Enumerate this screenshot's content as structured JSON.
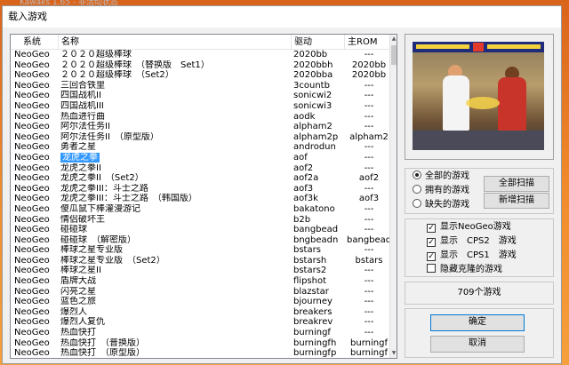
{
  "background_title": "Kawaks 1.65 - 非活动状态",
  "dialog": {
    "title": "载入游戏"
  },
  "list": {
    "columns": [
      "系统",
      "名称",
      "驱动",
      "主ROM"
    ],
    "rows": [
      {
        "sys": "NeoGeo",
        "name": "２０２０超级棒球",
        "drv": "2020bb",
        "main": "---"
      },
      {
        "sys": "NeoGeo",
        "name": "２０２０超级棒球　（替换版　Set1）",
        "drv": "2020bbh",
        "main": "2020bb"
      },
      {
        "sys": "NeoGeo",
        "name": "２０２０超级棒球　（Set2）",
        "drv": "2020bba",
        "main": "2020bb"
      },
      {
        "sys": "NeoGeo",
        "name": "三回合铁里",
        "drv": "3countb",
        "main": "---"
      },
      {
        "sys": "NeoGeo",
        "name": "四国战机II",
        "drv": "sonicwi2",
        "main": "---"
      },
      {
        "sys": "NeoGeo",
        "name": "四国战机III",
        "drv": "sonicwi3",
        "main": "---"
      },
      {
        "sys": "NeoGeo",
        "name": "热血进行曲",
        "drv": "aodk",
        "main": "---"
      },
      {
        "sys": "NeoGeo",
        "name": "阿尔法任务II",
        "drv": "alpham2",
        "main": "---"
      },
      {
        "sys": "NeoGeo",
        "name": "阿尔法任务II　（原型版）",
        "drv": "alpham2p",
        "main": "alpham2"
      },
      {
        "sys": "NeoGeo",
        "name": "勇者之星",
        "drv": "androdun",
        "main": "---"
      },
      {
        "sys": "NeoGeo",
        "name": "龙虎之拳",
        "drv": "aof",
        "main": "---",
        "selected": true
      },
      {
        "sys": "NeoGeo",
        "name": "龙虎之拳II",
        "drv": "aof2",
        "main": "---"
      },
      {
        "sys": "NeoGeo",
        "name": "龙虎之拳II　（Set2）",
        "drv": "aof2a",
        "main": "aof2"
      },
      {
        "sys": "NeoGeo",
        "name": "龙虎之拳III：斗士之路",
        "drv": "aof3",
        "main": "---"
      },
      {
        "sys": "NeoGeo",
        "name": "龙虎之拳III：斗士之路　（韩国版）",
        "drv": "aof3k",
        "main": "aof3"
      },
      {
        "sys": "NeoGeo",
        "name": "傻瓜鼠下棒灌漫游记",
        "drv": "bakatono",
        "main": "---"
      },
      {
        "sys": "NeoGeo",
        "name": "情侣破坏王",
        "drv": "b2b",
        "main": "---"
      },
      {
        "sys": "NeoGeo",
        "name": "碰碰球",
        "drv": "bangbead",
        "main": "---"
      },
      {
        "sys": "NeoGeo",
        "name": "碰碰球　（解密版）",
        "drv": "bngbeadn",
        "main": "bangbead"
      },
      {
        "sys": "NeoGeo",
        "name": "棒球之星专业版",
        "drv": "bstars",
        "main": "---"
      },
      {
        "sys": "NeoGeo",
        "name": "棒球之星专业版　（Set2）",
        "drv": "bstarsh",
        "main": "bstars"
      },
      {
        "sys": "NeoGeo",
        "name": "棒球之星II",
        "drv": "bstars2",
        "main": "---"
      },
      {
        "sys": "NeoGeo",
        "name": "盾牌大战",
        "drv": "flipshot",
        "main": "---"
      },
      {
        "sys": "NeoGeo",
        "name": "闪亮之星",
        "drv": "blazstar",
        "main": "---"
      },
      {
        "sys": "NeoGeo",
        "name": "蓝色之旅",
        "drv": "bjourney",
        "main": "---"
      },
      {
        "sys": "NeoGeo",
        "name": "爆烈人",
        "drv": "breakers",
        "main": "---"
      },
      {
        "sys": "NeoGeo",
        "name": "爆烈人复仇",
        "drv": "breakrev",
        "main": "---"
      },
      {
        "sys": "NeoGeo",
        "name": "热血快打",
        "drv": "burningf",
        "main": "---"
      },
      {
        "sys": "NeoGeo",
        "name": "热血快打　（普换版）",
        "drv": "burningfh",
        "main": "burningf"
      },
      {
        "sys": "NeoGeo",
        "name": "热血快打　（原型版）",
        "drv": "burningfp",
        "main": "burningf"
      }
    ]
  },
  "filter": {
    "options": [
      {
        "label": "全部的游戏",
        "checked": true
      },
      {
        "label": "拥有的游戏",
        "checked": false
      },
      {
        "label": "缺失的游戏",
        "checked": false
      }
    ],
    "scan_all": "全部扫描",
    "scan_new": "新增扫描"
  },
  "display": {
    "options": [
      {
        "label": "显示NeoGeo游戏",
        "checked": true
      },
      {
        "label": "显示　CPS2　游戏",
        "checked": true
      },
      {
        "label": "显示　CPS1　游戏",
        "checked": true
      },
      {
        "label": "隐藏克隆的游戏",
        "checked": false
      }
    ]
  },
  "count_text": "709个游戏",
  "ok": "确定",
  "cancel": "取消"
}
